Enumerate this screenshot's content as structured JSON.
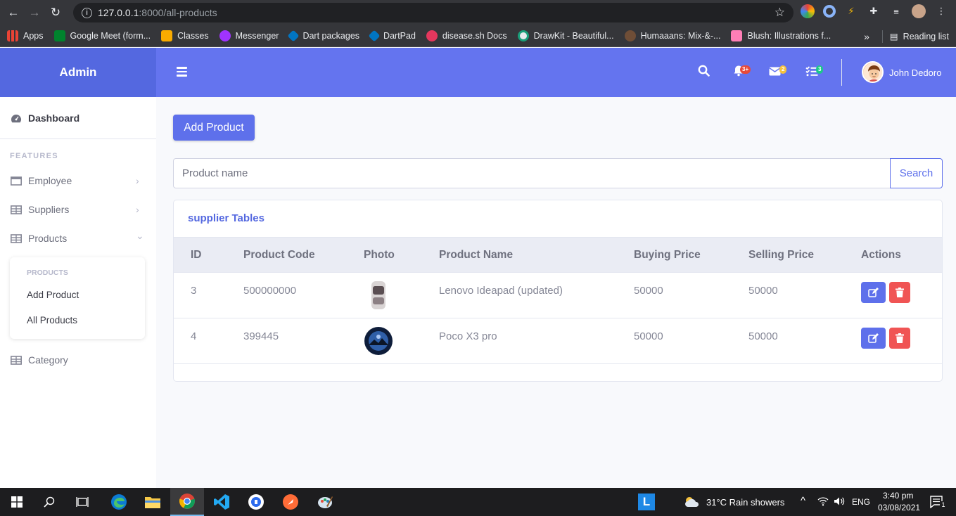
{
  "browser": {
    "url_host": "127.0.0.1",
    "url_rest": ":8000/all-products",
    "bookmarks": [
      {
        "label": "Apps",
        "color": "#e94235"
      },
      {
        "label": "Google Meet (form...",
        "color": "#00832d"
      },
      {
        "label": "Classes",
        "color": "#f9ab00"
      },
      {
        "label": "Messenger",
        "color": "#a033ff"
      },
      {
        "label": "Dart packages",
        "color": "#0175c2"
      },
      {
        "label": "DartPad",
        "color": "#0175c2"
      },
      {
        "label": "disease.sh Docs",
        "color": "#e5375d"
      },
      {
        "label": "DrawKit - Beautiful...",
        "color": "#e8eaed"
      },
      {
        "label": "Humaaans: Mix-&-...",
        "color": "#6f4e37"
      },
      {
        "label": "Blush: Illustrations f...",
        "color": "#ff7eb6"
      }
    ],
    "more": "»",
    "reading_list": "Reading list"
  },
  "sidebar": {
    "brand": "Admin",
    "dashboard": "Dashboard",
    "features_heading": "FEATURES",
    "items": [
      {
        "label": "Employee",
        "chevron": "›"
      },
      {
        "label": "Suppliers",
        "chevron": "›"
      },
      {
        "label": "Products",
        "chevron": "⌄"
      }
    ],
    "products_menu": {
      "heading": "PRODUCTS",
      "add": "Add Product",
      "all": "All Products"
    },
    "category": "Category"
  },
  "topbar": {
    "alerts_badge": "3+",
    "messages_badge": "2",
    "tasks_badge": "3",
    "user_name": "John Dedoro"
  },
  "content": {
    "add_button": "Add Product",
    "search_placeholder": "Product name",
    "search_button": "Search",
    "card_title": "supplier Tables",
    "columns": [
      "ID",
      "Product Code",
      "Photo",
      "Product Name",
      "Buying Price",
      "Selling Price",
      "Actions"
    ],
    "rows": [
      {
        "id": "3",
        "code": "500000000",
        "name": "Lenovo Ideapad (updated)",
        "buy": "50000",
        "sell": "50000"
      },
      {
        "id": "4",
        "code": "399445",
        "name": "Poco X3 pro",
        "buy": "50000",
        "sell": "50000"
      }
    ]
  },
  "taskbar": {
    "weather": "31°C  Rain showers",
    "lang": "ENG",
    "time": "3:40 pm",
    "date": "03/08/2021",
    "notif_count": "1"
  },
  "colors": {
    "primary": "#6474ef",
    "danger": "#f05454"
  }
}
